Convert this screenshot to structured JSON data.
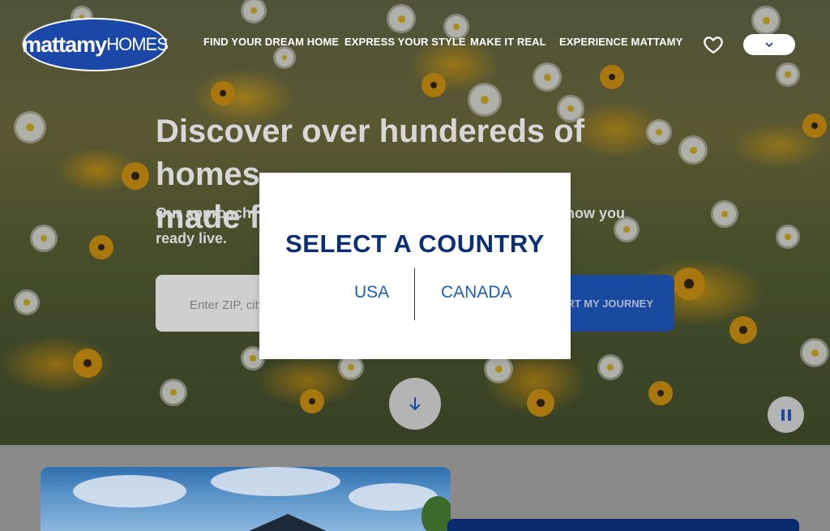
{
  "header": {
    "logo": {
      "part1": "mattamy",
      "part2": "HOMES"
    },
    "nav": [
      {
        "label": "FIND YOUR DREAM HOME"
      },
      {
        "label": "EXPRESS YOUR STYLE"
      },
      {
        "label": "MAKE IT REAL"
      },
      {
        "label": "EXPERIENCE MATTAMY"
      }
    ],
    "icons": {
      "favorites": "heart-icon",
      "country_dropdown": "chevron-down-icon"
    }
  },
  "hero": {
    "title_line1": "Discover over hundereds of homes",
    "title_line2": "made for you",
    "subtitle_start": "Our approach",
    "subtitle_end": "g how you",
    "subtitle_line2": "ready live.",
    "search": {
      "placeholder": "Enter ZIP, city"
    },
    "cta_label": "ART MY JOURNEY",
    "icons": {
      "scroll": "arrow-down-icon",
      "pause": "pause-icon"
    }
  },
  "modal": {
    "title": "SELECT A COUNTRY",
    "options": [
      {
        "label": "USA"
      },
      {
        "label": "CANADA"
      }
    ]
  },
  "colors": {
    "brand_blue": "#1b47a8",
    "modal_title": "#0b2f75",
    "country_link": "#1b5fb5"
  }
}
